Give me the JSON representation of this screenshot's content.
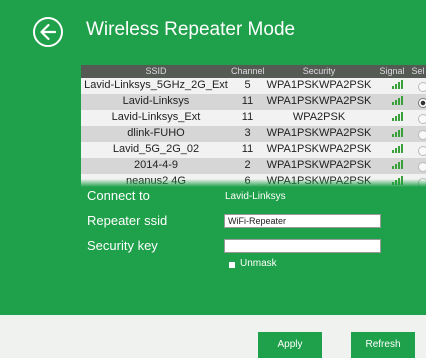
{
  "page": {
    "title": "Wireless Repeater Mode"
  },
  "table": {
    "headers": {
      "ssid": "SSID",
      "channel": "Channel",
      "security": "Security",
      "signal": "Signal",
      "select": "Sel"
    },
    "rows": [
      {
        "ssid": "Lavid-Linksys_5GHz_2G_Ext",
        "channel": "5",
        "security": "WPA1PSKWPA2PSK",
        "signal_icon": "signal-bars-icon",
        "selected": false
      },
      {
        "ssid": "Lavid-Linksys",
        "channel": "11",
        "security": "WPA1PSKWPA2PSK",
        "signal_icon": "signal-bars-icon",
        "selected": true
      },
      {
        "ssid": "Lavid-Linksys_Ext",
        "channel": "11",
        "security": "WPA2PSK",
        "signal_icon": "signal-bars-icon",
        "selected": false
      },
      {
        "ssid": "dlink-FUHO",
        "channel": "3",
        "security": "WPA1PSKWPA2PSK",
        "signal_icon": "signal-bars-icon",
        "selected": false
      },
      {
        "ssid": "Lavid_5G_2G_02",
        "channel": "11",
        "security": "WPA1PSKWPA2PSK",
        "signal_icon": "signal-bars-icon",
        "selected": false
      },
      {
        "ssid": "2014-4-9",
        "channel": "2",
        "security": "WPA1PSKWPA2PSK",
        "signal_icon": "signal-bars-icon",
        "selected": false
      },
      {
        "ssid": "neanus2 4G",
        "channel": "6",
        "security": "WPA1PSKWPA2PSK",
        "signal_icon": "signal-bars-icon",
        "selected": false
      }
    ]
  },
  "form": {
    "connect_to_label": "Connect to",
    "connect_to_value": "Lavid-Linksys",
    "repeater_ssid_label": "Repeater ssid",
    "repeater_ssid_value": "WiFi-Repeater",
    "security_key_label": "Security key",
    "security_key_value": "",
    "unmask_label": "Unmask"
  },
  "buttons": {
    "apply": "Apply",
    "refresh": "Refresh"
  },
  "colors": {
    "panel": "#1fa04a",
    "header": "#555a55",
    "background": "#f0f2f0"
  }
}
